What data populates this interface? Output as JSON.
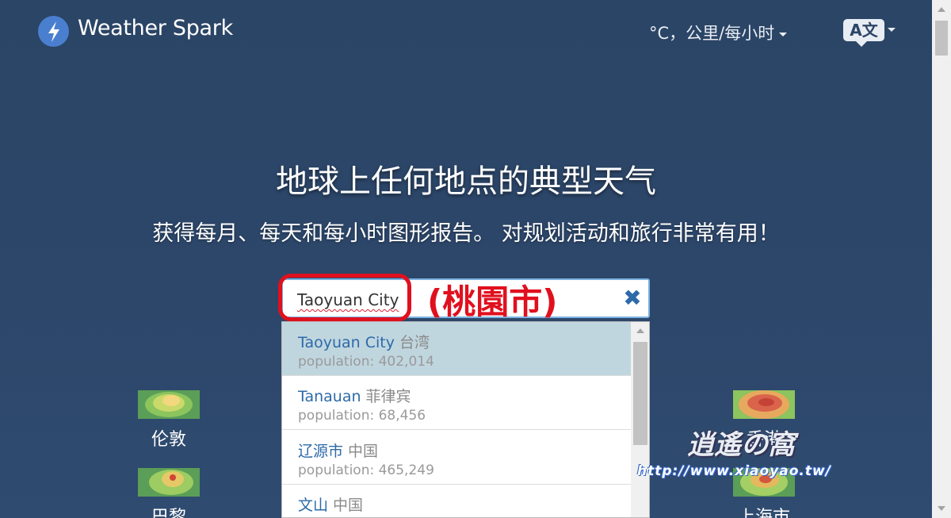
{
  "header": {
    "brand": "Weather Spark",
    "units": "°C，公里/每小时",
    "language_icon": "translate-icon",
    "language_glyph": "A文"
  },
  "hero": {
    "title": "地球上任何地点的典型天气",
    "subtitle": "获得每月、每天和每小时图形报告。 对规划活动和旅行非常有用！"
  },
  "search": {
    "value": "Taoyuan City",
    "clear_label": "✖"
  },
  "annotation": {
    "text": "(桃園市)"
  },
  "suggestions": [
    {
      "name": "Taoyuan City",
      "region": "台湾",
      "population": "population: 402,014",
      "selected": true
    },
    {
      "name": "Tanauan",
      "region": "菲律宾",
      "population": "population: 68,456",
      "selected": false
    },
    {
      "name": "辽源市",
      "region": "中国",
      "population": "population: 465,249",
      "selected": false
    },
    {
      "name": "文山",
      "region": "中国",
      "population": "",
      "selected": false
    }
  ],
  "cities": [
    {
      "name": "伦敦"
    },
    {
      "name": "巴黎"
    },
    {
      "name": "香港"
    },
    {
      "name": "上海市"
    }
  ],
  "watermark": {
    "site": "逍遙の窩",
    "url": "http://www.xiaoyao.tw/"
  },
  "colors": {
    "background": "#2b4566",
    "link": "#2d6aa8",
    "annotation": "#e0101e",
    "selected_row": "#c0d6df"
  }
}
